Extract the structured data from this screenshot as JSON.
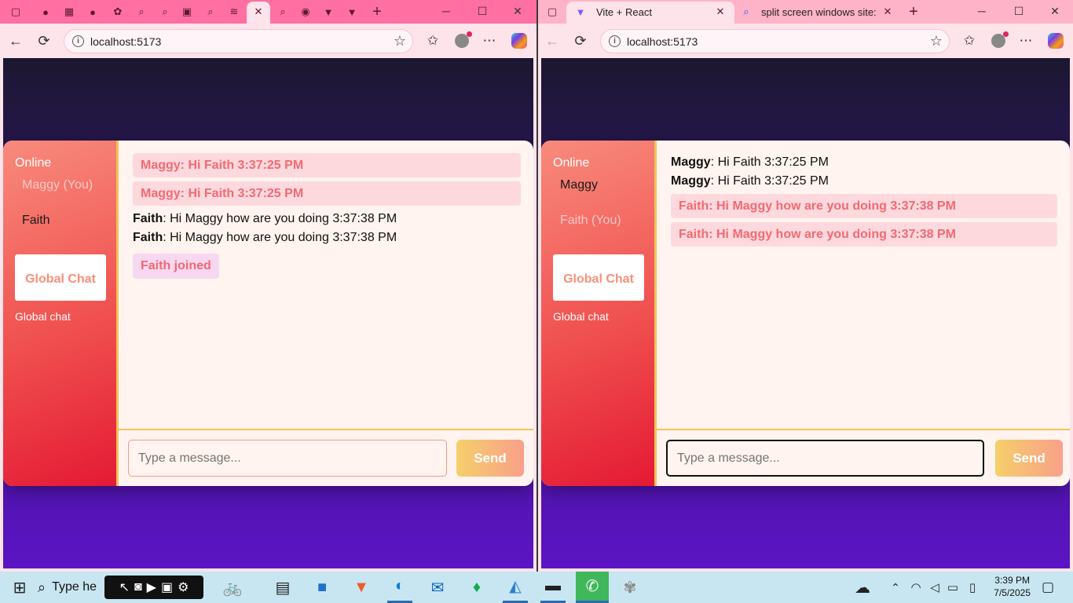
{
  "left_window": {
    "tab_icons": [
      "window-icon",
      "github-icon",
      "app-icon",
      "github-icon",
      "app-icon",
      "search-icon",
      "search-icon",
      "app-icon",
      "search-icon",
      "app-icon",
      "close-icon",
      "search-icon",
      "app-icon",
      "vite-icon",
      "vite-icon"
    ],
    "new_tab": "+",
    "url": "localhost:5173"
  },
  "right_window": {
    "tabs": [
      {
        "label": "Vite + React",
        "icon": "vite-icon"
      },
      {
        "label": "split screen windows site:m",
        "icon": "search-icon"
      }
    ],
    "new_tab": "+",
    "url": "localhost:5173"
  },
  "window_controls": {
    "minimize": "─",
    "maximize": "☐",
    "close": "✕"
  },
  "left_chat": {
    "online_label": "Online",
    "users": [
      {
        "name": "Maggy (You)",
        "state": "muted"
      },
      {
        "name": "Faith",
        "state": "active"
      }
    ],
    "global_button": "Global Chat",
    "global_label": "Global chat",
    "messages": [
      {
        "type": "highlight",
        "text": "Maggy: Hi Faith 3:37:25 PM"
      },
      {
        "type": "highlight",
        "text": "Maggy: Hi Faith 3:37:25 PM"
      },
      {
        "type": "plain",
        "sender": "Faith",
        "text": ": Hi Maggy how are you doing 3:37:38 PM"
      },
      {
        "type": "plain",
        "sender": "Faith",
        "text": ": Hi Maggy how are you doing 3:37:38 PM"
      },
      {
        "type": "join",
        "text": "Faith joined"
      }
    ],
    "input_placeholder": "Type a message...",
    "send_label": "Send"
  },
  "right_chat": {
    "online_label": "Online",
    "users": [
      {
        "name": "Maggy",
        "state": "active"
      },
      {
        "name": "Faith (You)",
        "state": "muted"
      }
    ],
    "global_button": "Global Chat",
    "global_label": "Global chat",
    "messages": [
      {
        "type": "plain",
        "sender": "Maggy",
        "text": ": Hi Faith 3:37:25 PM"
      },
      {
        "type": "plain",
        "sender": "Maggy",
        "text": ": Hi Faith 3:37:25 PM"
      },
      {
        "type": "highlight",
        "text": "Faith: Hi Maggy how are you doing 3:37:38 PM"
      },
      {
        "type": "highlight",
        "text": "Faith: Hi Maggy how are you doing 3:37:38 PM"
      }
    ],
    "input_placeholder": "Type a message...",
    "send_label": "Send"
  },
  "taskbar": {
    "search_text": "Type he",
    "time": "3:39 PM",
    "date": "7/5/2025"
  },
  "colors": {
    "sidebar_gradient_start": "#f88a7c",
    "sidebar_gradient_end": "#e41a34",
    "highlight_bg": "#fdd9de",
    "highlight_text": "#f26a72",
    "send_gradient": [
      "#f6cf6a",
      "#f9a08a"
    ],
    "page_background_top": "#1c1730",
    "page_background_bottom": "#5b14c4"
  }
}
